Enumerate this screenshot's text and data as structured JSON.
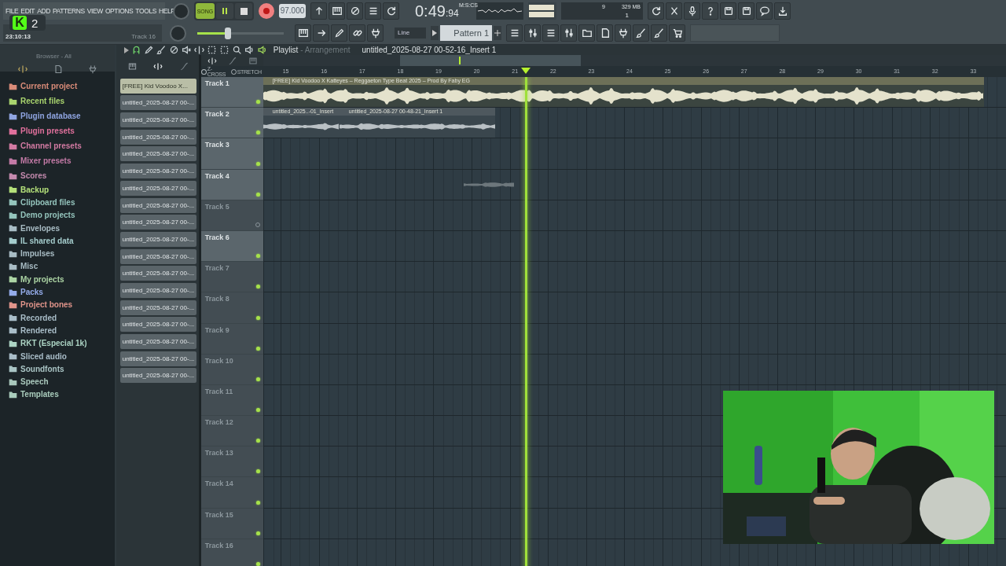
{
  "menu": [
    "FILE",
    "EDIT",
    "ADD",
    "PATTERNS",
    "VIEW",
    "OPTIONS",
    "TOOLS",
    "HELP"
  ],
  "overlay_badge": {
    "logo": "K",
    "count": "2"
  },
  "hint_bar": {
    "time": "23:10:13",
    "text": "Track 16"
  },
  "transport": {
    "mode": {
      "label": "SONG",
      "selected": true
    },
    "playing": true,
    "tempo": "97.000"
  },
  "master_volume": {
    "level": 0.35
  },
  "clock": {
    "time": "0:49",
    "centiseconds": ":94",
    "format": "M:S:CS"
  },
  "monitor": {
    "voices": "9",
    "memory": "329 MB",
    "cores": "1"
  },
  "snap": "Line",
  "pattern": "Pattern 1",
  "browser": {
    "path": "Browser - All",
    "items": [
      {
        "label": "Current project",
        "color": "#d98b78"
      },
      {
        "label": "Recent files",
        "color": "#a9d46e"
      },
      {
        "label": "Plugin database",
        "color": "#8fa4e0"
      },
      {
        "label": "Plugin presets",
        "color": "#e0709c"
      },
      {
        "label": "Channel presets",
        "color": "#d27aa2"
      },
      {
        "label": "Mixer presets",
        "color": "#c37aa6"
      },
      {
        "label": "Scores",
        "color": "#c48aae"
      },
      {
        "label": "Backup",
        "color": "#b4e07a"
      },
      {
        "label": "Clipboard files",
        "color": "#94c4bc"
      },
      {
        "label": "Demo projects",
        "color": "#94c4bc"
      },
      {
        "label": "Envelopes",
        "color": "#a8bcc4"
      },
      {
        "label": "IL shared data",
        "color": "#a4cccc"
      },
      {
        "label": "Impulses",
        "color": "#a8bcc4"
      },
      {
        "label": "Misc",
        "color": "#a8bcc4"
      },
      {
        "label": "My projects",
        "color": "#acd4a4"
      },
      {
        "label": "Packs",
        "color": "#94acea"
      },
      {
        "label": "Project bones",
        "color": "#e0948a"
      },
      {
        "label": "Recorded",
        "color": "#a9bdc8"
      },
      {
        "label": "Rendered",
        "color": "#a9bdc8"
      },
      {
        "label": "RKT (Especial 1k)",
        "color": "#acd4c4"
      },
      {
        "label": "Sliced audio",
        "color": "#a9bdc8"
      },
      {
        "label": "Soundfonts",
        "color": "#a9c4c4"
      },
      {
        "label": "Speech",
        "color": "#a9c8bc"
      },
      {
        "label": "Templates",
        "color": "#a9ccbc"
      }
    ]
  },
  "clip_list": [
    {
      "label": "[FREE] Kid Voodoo X...",
      "selected": true
    },
    {
      "label": "untitled_2025-08-27 00-...",
      "selected": false
    },
    {
      "label": "untitled_2025-08-27 00-...",
      "selected": false
    },
    {
      "label": "untitled_2025-08-27 00-...",
      "selected": false
    },
    {
      "label": "untitled_2025-08-27 00-...",
      "selected": false
    },
    {
      "label": "untitled_2025-08-27 00-...",
      "selected": false
    },
    {
      "label": "untitled_2025-08-27 00-...",
      "selected": false
    },
    {
      "label": "untitled_2025-08-27 00-...",
      "selected": false
    },
    {
      "label": "untitled_2025-08-27 00-...",
      "selected": false
    },
    {
      "label": "untitled_2025-08-27 00-...",
      "selected": false
    },
    {
      "label": "untitled_2025-08-27 00-...",
      "selected": false
    },
    {
      "label": "untitled_2025-08-27 00-...",
      "selected": false
    },
    {
      "label": "untitled_2025-08-27 00-...",
      "selected": false
    },
    {
      "label": "untitled_2025-08-27 00-...",
      "selected": false
    },
    {
      "label": "untitled_2025-08-27 00-...",
      "selected": false
    },
    {
      "label": "untitled_2025-08-27 00-...",
      "selected": false
    },
    {
      "label": "untitled_2025-08-27 00-...",
      "selected": false
    },
    {
      "label": "untitled_2025-08-27 00-...",
      "selected": false
    }
  ],
  "playlist": {
    "title": "Playlist",
    "subtitle": "- Arrangement",
    "clip": "untitled_2025-08-27 00-52-16_Insert 1",
    "options": [
      "Z-CROSS",
      "STRETCH"
    ],
    "bars": [
      "15",
      "16",
      "17",
      "18",
      "19",
      "20",
      "21",
      "22",
      "23",
      "24",
      "25",
      "26",
      "27",
      "28",
      "29",
      "30",
      "31",
      "32",
      "33"
    ],
    "tracks": [
      {
        "name": "Track 1",
        "selected": true,
        "enabled": true,
        "clips": [
          {
            "kind": "audio",
            "title": "[FREE] Kid Voodoo X Katteyes – Reggaeton Type Beat 2025 – Prod By Faby EG"
          }
        ]
      },
      {
        "name": "Track 2",
        "selected": true,
        "enabled": true,
        "clips": [
          {
            "kind": "audio",
            "title": "untitled_2025..-01_Insert"
          },
          {
            "kind": "audio",
            "title": "untitled_2025-08-27 00-48-21_Insert 1"
          }
        ]
      },
      {
        "name": "Track 3",
        "selected": true,
        "enabled": true
      },
      {
        "name": "Track 4",
        "selected": true,
        "enabled": true,
        "clips": [
          {
            "kind": "fragment"
          }
        ]
      },
      {
        "name": "Track 5",
        "selected": false,
        "enabled": false
      },
      {
        "name": "Track 6",
        "selected": true,
        "enabled": true
      },
      {
        "name": "Track 7",
        "selected": false,
        "enabled": true
      },
      {
        "name": "Track 8",
        "selected": false,
        "enabled": true
      },
      {
        "name": "Track 9",
        "selected": false,
        "enabled": true
      },
      {
        "name": "Track 10",
        "selected": false,
        "enabled": true
      },
      {
        "name": "Track 11",
        "selected": false,
        "enabled": true
      },
      {
        "name": "Track 12",
        "selected": false,
        "enabled": true
      },
      {
        "name": "Track 13",
        "selected": false,
        "enabled": true
      },
      {
        "name": "Track 14",
        "selected": false,
        "enabled": true
      },
      {
        "name": "Track 15",
        "selected": false,
        "enabled": true
      },
      {
        "name": "Track 16",
        "selected": false,
        "enabled": true
      }
    ]
  }
}
